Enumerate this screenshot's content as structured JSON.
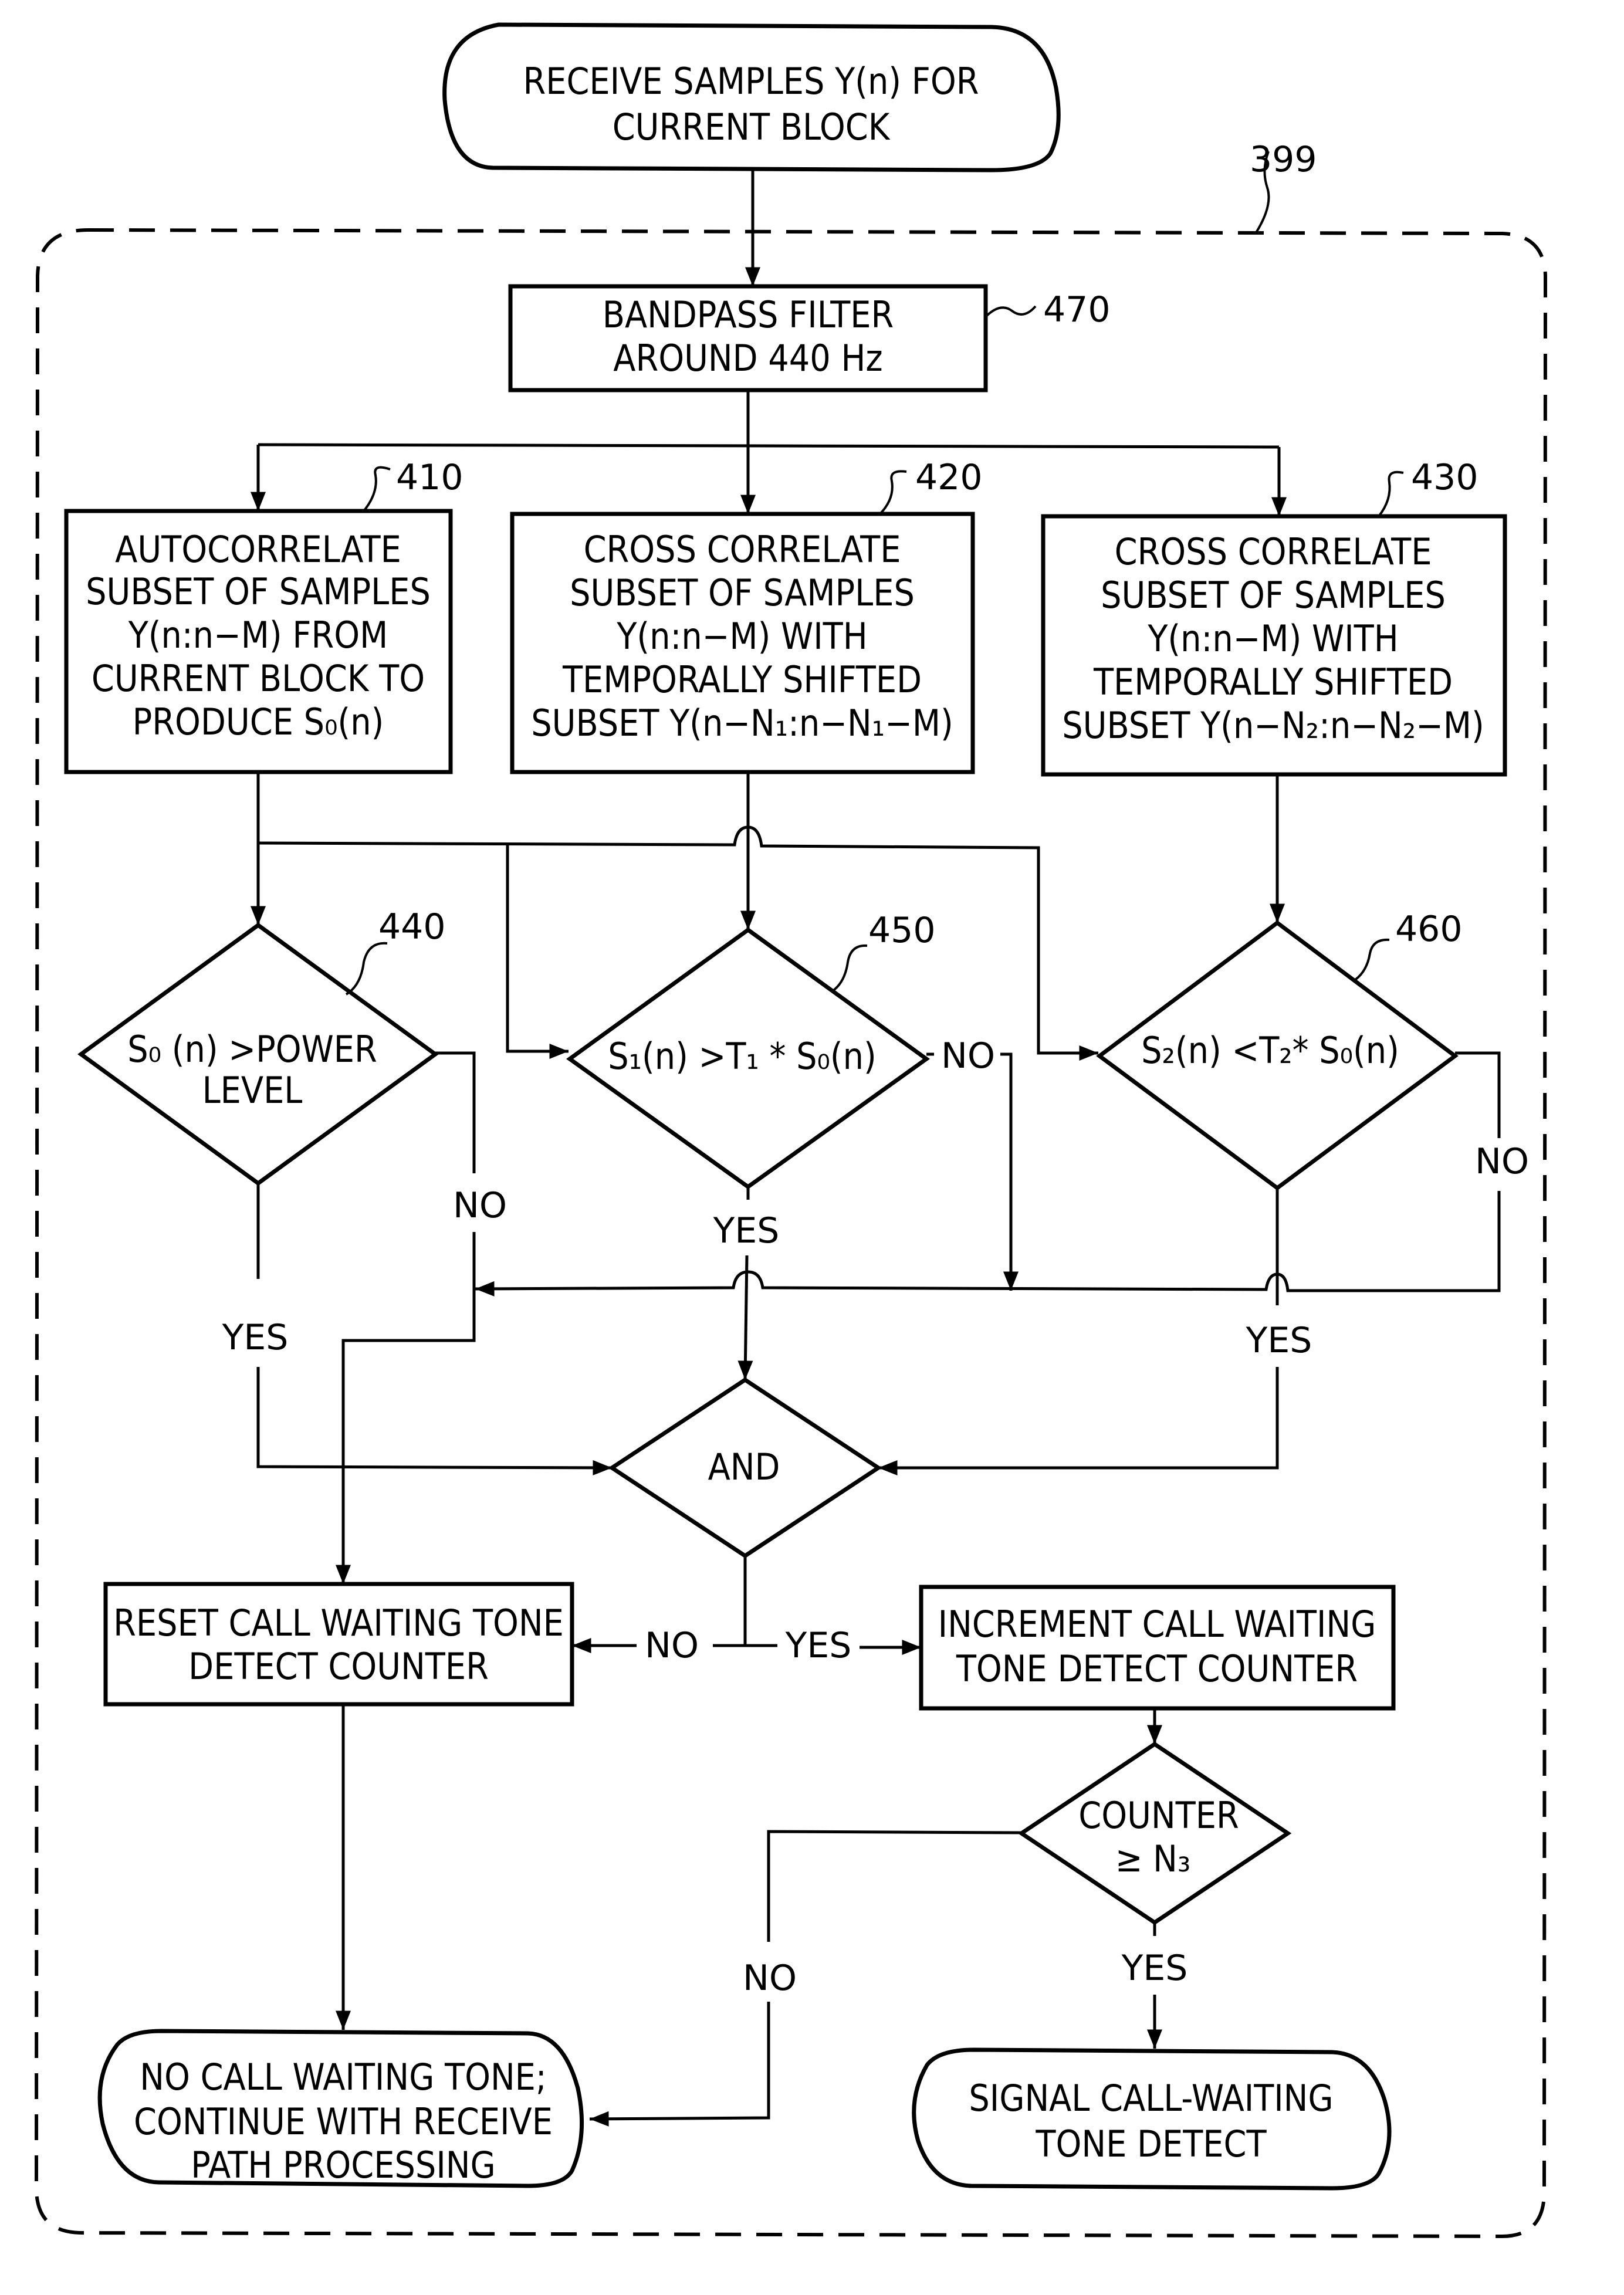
{
  "figure": {
    "type": "flowchart",
    "region_ref": "399",
    "start": {
      "lines": [
        "RECEIVE SAMPLES Y(n) FOR",
        "CURRENT BLOCK"
      ]
    },
    "bandpass": {
      "ref": "470",
      "lines": [
        "BANDPASS FILTER",
        "AROUND 440 Hz"
      ]
    },
    "autocorrelate": {
      "ref": "410",
      "lines": [
        "AUTOCORRELATE",
        "SUBSET OF SAMPLES",
        "Y(n:n−M) FROM",
        "CURRENT BLOCK TO",
        "PRODUCE S₀(n)"
      ]
    },
    "crosscorr1": {
      "ref": "420",
      "lines": [
        "CROSS CORRELATE",
        "SUBSET OF SAMPLES",
        "Y(n:n−M) WITH",
        "TEMPORALLY SHIFTED",
        "SUBSET Y(n−N₁:n−N₁−M)"
      ]
    },
    "crosscorr2": {
      "ref": "430",
      "lines": [
        "CROSS CORRELATE",
        "SUBSET OF SAMPLES",
        "Y(n:n−M) WITH",
        "TEMPORALLY SHIFTED",
        "SUBSET Y(n−N₂:n−N₂−M)"
      ]
    },
    "decision_power": {
      "ref": "440",
      "lines": [
        "S₀ (n) >POWER",
        "LEVEL"
      ],
      "yes": "YES",
      "no": "NO"
    },
    "decision_s1": {
      "ref": "450",
      "lines": [
        "S₁(n) >T₁ * S₀(n)"
      ],
      "yes": "YES",
      "no": "NO"
    },
    "decision_s2": {
      "ref": "460",
      "lines": [
        "S₂(n) <T₂* S₀(n)"
      ],
      "yes": "YES",
      "no": "NO"
    },
    "and_gate": {
      "label": "AND",
      "yes": "YES",
      "no": "NO"
    },
    "reset_counter": {
      "lines": [
        "RESET CALL WAITING TONE",
        "DETECT COUNTER"
      ]
    },
    "increment_counter": {
      "lines": [
        "INCREMENT CALL WAITING",
        "TONE DETECT COUNTER"
      ]
    },
    "counter_check": {
      "lines": [
        "COUNTER",
        "≥ N₃"
      ],
      "yes": "YES",
      "no": "NO"
    },
    "end_no_tone": {
      "lines": [
        "NO CALL WAITING TONE;",
        "CONTINUE WITH RECEIVE",
        "PATH PROCESSING"
      ]
    },
    "end_signal": {
      "lines": [
        "SIGNAL CALL-WAITING",
        "TONE DETECT"
      ]
    }
  }
}
